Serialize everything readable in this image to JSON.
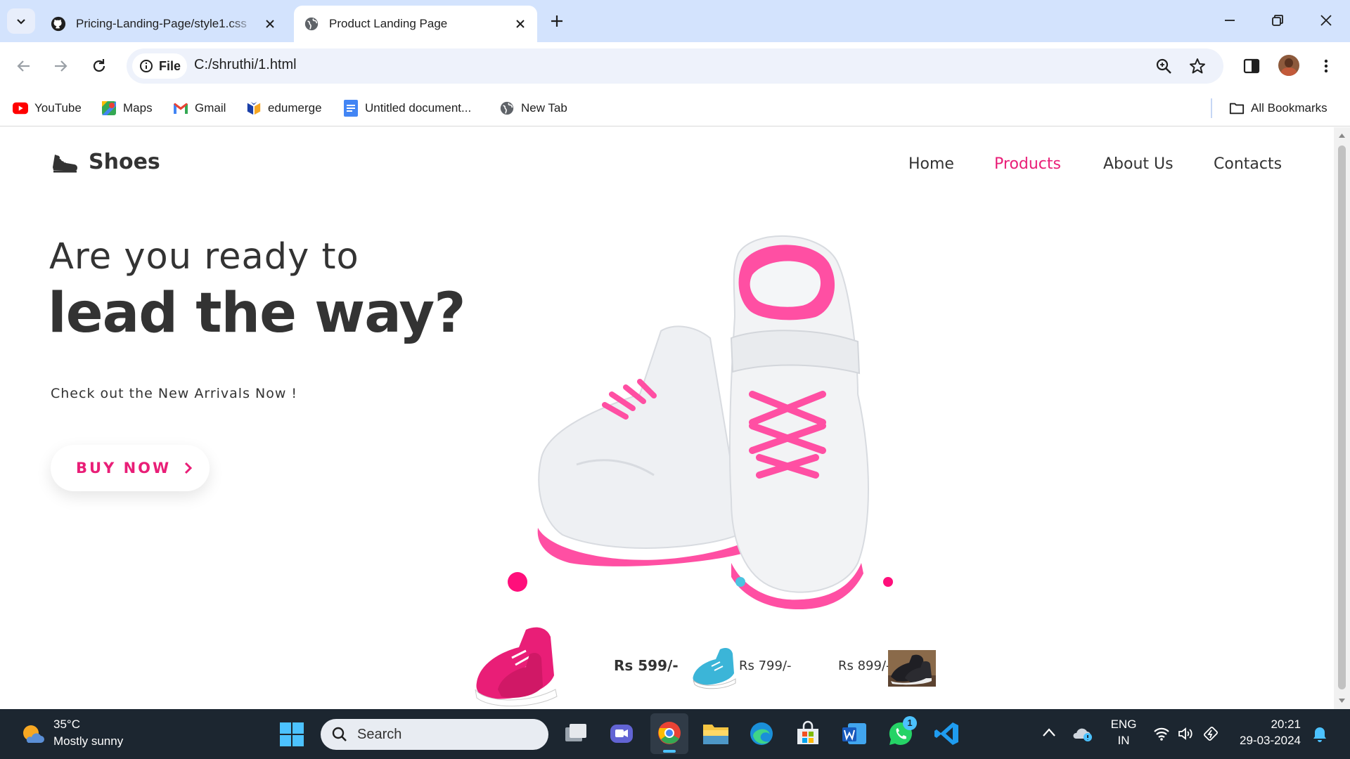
{
  "browser": {
    "tabs": [
      {
        "title": "Pricing-Landing-Page/style1.css",
        "active": false,
        "icon": "github-icon"
      },
      {
        "title": "Product Landing Page",
        "active": true,
        "icon": "globe-icon"
      }
    ],
    "address": {
      "chip": "File",
      "url": "C:/shruthi/1.html"
    },
    "bookmarks": [
      {
        "label": "YouTube",
        "icon": "youtube-icon"
      },
      {
        "label": "Maps",
        "icon": "maps-icon"
      },
      {
        "label": "Gmail",
        "icon": "gmail-icon"
      },
      {
        "label": "edumerge",
        "icon": "edumerge-icon"
      },
      {
        "label": "Untitled document...",
        "icon": "docs-icon"
      },
      {
        "label": "New Tab",
        "icon": "globe-icon"
      }
    ],
    "all_bookmarks": "All Bookmarks"
  },
  "page": {
    "logo": "Shoes",
    "nav": [
      {
        "label": "Home",
        "active": false
      },
      {
        "label": "Products",
        "active": true
      },
      {
        "label": "About Us",
        "active": false
      },
      {
        "label": "Contacts",
        "active": false
      }
    ],
    "hero": {
      "line1": "Are you ready to",
      "line2": "lead the way?",
      "subtitle": "Check out the New Arrivals Now !",
      "button": "BUY NOW"
    },
    "products": [
      {
        "price": "Rs 599/-",
        "color": "#e91e77"
      },
      {
        "price": "Rs 799/-",
        "color": "#3bb5d8"
      },
      {
        "price": "Rs 899/-",
        "color": "#333333"
      }
    ]
  },
  "colors": {
    "accent": "#e91e77",
    "text": "#333333",
    "tabbar": "#d3e3fd",
    "teal": "#4cc3e0"
  },
  "taskbar": {
    "weather_temp": "35°C",
    "weather_desc": "Mostly sunny",
    "search_placeholder": "Search",
    "whatsapp_badge": "1",
    "lang_line1": "ENG",
    "lang_line2": "IN",
    "time": "20:21",
    "date": "29-03-2024"
  }
}
